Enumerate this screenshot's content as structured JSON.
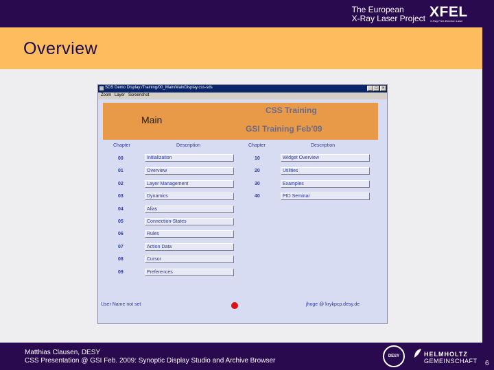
{
  "header": {
    "org_line1": "The European",
    "org_line2": "X-Ray Laser Project",
    "logo_text": "XFEL",
    "logo_subtext": "X-Ray Free-Electron Laser"
  },
  "slide": {
    "title": "Overview",
    "page_number": "6"
  },
  "footer": {
    "author": "Matthias Clausen, DESY",
    "presentation": "CSS Presentation @ GSI Feb. 2009: Synoptic Display Studio and Archive Browser",
    "desy_logo_text": "DESY",
    "helmholtz_line1": "HELMHOLTZ",
    "helmholtz_line2": "GEMEINSCHAFT"
  },
  "app_window": {
    "title": "SDS Demo Display:/Training/00_Main/MainDisplay.css-sds",
    "menu": [
      "Zoom",
      "Layer",
      "Screenshot"
    ],
    "controls": [
      "_",
      "□",
      "×"
    ],
    "header_main": "Main",
    "header_css": "CSS Training",
    "header_gsi": "GSI Training Feb'09",
    "col_chapter": "Chapter",
    "col_description": "Description",
    "chapters_left": [
      {
        "num": "00",
        "label": "Initialization"
      },
      {
        "num": "01",
        "label": "Overview"
      },
      {
        "num": "02",
        "label": "Layer Management"
      },
      {
        "num": "03",
        "label": "Dynamics"
      },
      {
        "num": "04",
        "label": "Alias"
      },
      {
        "num": "05",
        "label": "Connection-States"
      },
      {
        "num": "06",
        "label": "Rules"
      },
      {
        "num": "07",
        "label": "Action Data"
      },
      {
        "num": "08",
        "label": "Cursor"
      },
      {
        "num": "09",
        "label": "Preferences"
      }
    ],
    "chapters_right": [
      {
        "num": "10",
        "label": "Widget Overview"
      },
      {
        "num": "20",
        "label": "Utilities"
      },
      {
        "num": "30",
        "label": "Examples"
      },
      {
        "num": "40",
        "label": "PID Seminar"
      }
    ],
    "user_status": "User Name not set",
    "user_email": "jhoge @ krykpcp.desy.de",
    "status_color": "#dd1111"
  },
  "colors": {
    "brand_purple": "#2a0a4e",
    "title_orange": "#fdbd5e",
    "app_header_orange": "#e89a48",
    "link_blue": "#2a3a9a"
  }
}
